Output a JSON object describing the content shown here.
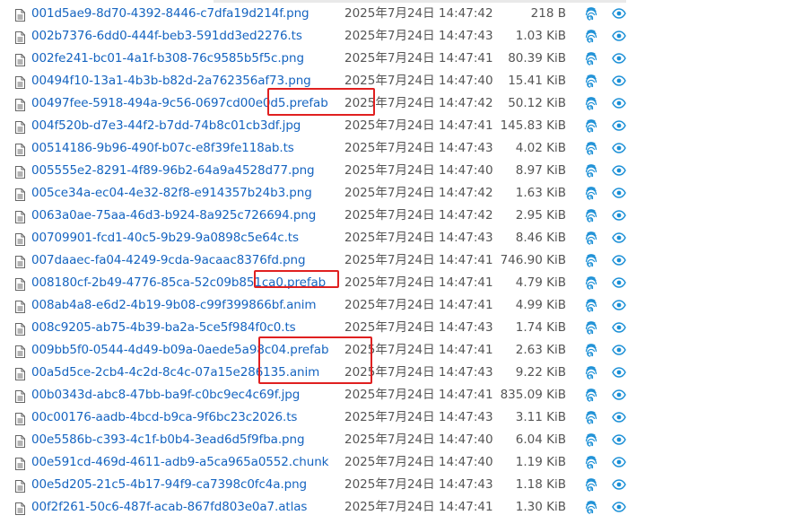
{
  "files": [
    {
      "name": "001d5ae9-8d70-4392-8446-c7dfa19d214f.png",
      "date": "2025年7月24日 14:47:42",
      "size": "218 B"
    },
    {
      "name": "002b7376-6dd0-444f-beb3-591dd3ed2276.ts",
      "date": "2025年7月24日 14:47:43",
      "size": "1.03 KiB"
    },
    {
      "name": "002fe241-bc01-4a1f-b308-76c9585b5f5c.png",
      "date": "2025年7月24日 14:47:41",
      "size": "80.39 KiB"
    },
    {
      "name": "00494f10-13a1-4b3b-b82d-2a762356af73.png",
      "date": "2025年7月24日 14:47:40",
      "size": "15.41 KiB"
    },
    {
      "name": "00497fee-5918-494a-9c56-0697cd00e0d5.prefab",
      "date": "2025年7月24日 14:47:42",
      "size": "50.12 KiB"
    },
    {
      "name": "004f520b-d7e3-44f2-b7dd-74b8c01cb3df.jpg",
      "date": "2025年7月24日 14:47:41",
      "size": "145.83 KiB"
    },
    {
      "name": "00514186-9b96-490f-b07c-e8f39fe118ab.ts",
      "date": "2025年7月24日 14:47:43",
      "size": "4.02 KiB"
    },
    {
      "name": "005555e2-8291-4f89-96b2-64a9a4528d77.png",
      "date": "2025年7月24日 14:47:40",
      "size": "8.97 KiB"
    },
    {
      "name": "005ce34a-ec04-4e32-82f8-e914357b24b3.png",
      "date": "2025年7月24日 14:47:42",
      "size": "1.63 KiB"
    },
    {
      "name": "0063a0ae-75aa-46d3-b924-8a925c726694.png",
      "date": "2025年7月24日 14:47:42",
      "size": "2.95 KiB"
    },
    {
      "name": "00709901-fcd1-40c5-9b29-9a0898c5e64c.ts",
      "date": "2025年7月24日 14:47:43",
      "size": "8.46 KiB"
    },
    {
      "name": "007daaec-fa04-4249-9cda-9acaac8376fd.png",
      "date": "2025年7月24日 14:47:41",
      "size": "746.90 KiB"
    },
    {
      "name": "008180cf-2b49-4776-85ca-52c09b851ca0.prefab",
      "date": "2025年7月24日 14:47:41",
      "size": "4.79 KiB"
    },
    {
      "name": "008ab4a8-e6d2-4b19-9b08-c99f399866bf.anim",
      "date": "2025年7月24日 14:47:41",
      "size": "4.99 KiB"
    },
    {
      "name": "008c9205-ab75-4b39-ba2a-5ce5f984f0c0.ts",
      "date": "2025年7月24日 14:47:43",
      "size": "1.74 KiB"
    },
    {
      "name": "009bb5f0-0544-4d49-b09a-0aede5a98c04.prefab",
      "date": "2025年7月24日 14:47:41",
      "size": "2.63 KiB"
    },
    {
      "name": "00a5d5ce-2cb4-4c2d-8c4c-07a15e286135.anim",
      "date": "2025年7月24日 14:47:43",
      "size": "9.22 KiB"
    },
    {
      "name": "00b0343d-abc8-47bb-ba9f-c0bc9ec4c69f.jpg",
      "date": "2025年7月24日 14:47:41",
      "size": "835.09 KiB"
    },
    {
      "name": "00c00176-aadb-4bcd-b9ca-9f6bc23c2026.ts",
      "date": "2025年7月24日 14:47:43",
      "size": "3.11 KiB"
    },
    {
      "name": "00e5586b-c393-4c1f-b0b4-3ead6d5f9fba.png",
      "date": "2025年7月24日 14:47:40",
      "size": "6.04 KiB"
    },
    {
      "name": "00e591cd-469d-4611-adb9-a5ca965a0552.chunk",
      "date": "2025年7月24日 14:47:40",
      "size": "1.19 KiB"
    },
    {
      "name": "00e5d205-21c5-4b17-94f9-ca7398c0fc4a.png",
      "date": "2025年7月24日 14:47:43",
      "size": "1.18 KiB"
    },
    {
      "name": "00f2f261-50c6-487f-acab-867fd803e0a7.atlas",
      "date": "2025年7月24日 14:47:41",
      "size": "1.30 KiB"
    }
  ],
  "colors": {
    "link": "#1564c0",
    "muted": "#555555",
    "icon": "#1a8fd6",
    "highlight": "#e02020"
  }
}
